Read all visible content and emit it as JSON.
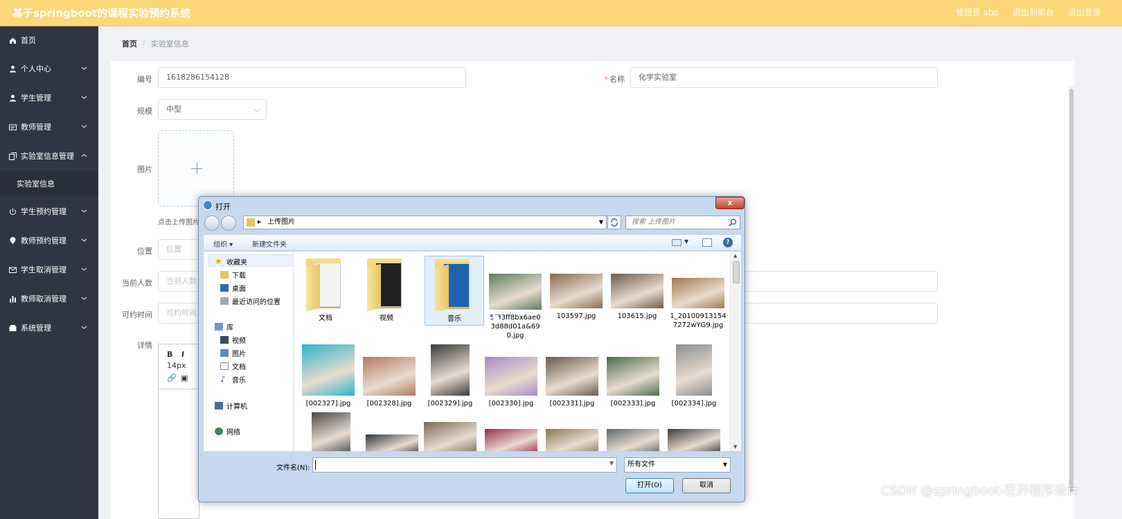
{
  "header": {
    "app_title": "基于springboot的课程实验预约系统",
    "user_label": "管理员 abo",
    "front_link": "退出到前台",
    "logout_link": "退出登录"
  },
  "sidebar": {
    "items": [
      {
        "label": "首页",
        "icon": "home-icon"
      },
      {
        "label": "个人中心",
        "icon": "user-icon"
      },
      {
        "label": "学生管理",
        "icon": "user-icon"
      },
      {
        "label": "教师管理",
        "icon": "id-card-icon"
      },
      {
        "label": "实验室信息管理",
        "icon": "copy-icon"
      },
      {
        "label": "学生预约管理",
        "icon": "power-icon"
      },
      {
        "label": "教师预约管理",
        "icon": "location-icon"
      },
      {
        "label": "学生取消管理",
        "icon": "mail-icon"
      },
      {
        "label": "教师取消管理",
        "icon": "bar-chart-icon"
      },
      {
        "label": "系统管理",
        "icon": "folder-icon"
      }
    ],
    "sub_item": "实验室信息"
  },
  "breadcrumb": {
    "home": "首页",
    "separator": "/",
    "current": "实验室信息"
  },
  "form": {
    "number_label": "编号",
    "number_value": "1618286154128",
    "name_label": "名称",
    "name_value": "化学实验室",
    "scale_label": "规模",
    "scale_value": "中型",
    "image_label": "图片",
    "upload_tip": "点击上传图片",
    "location_label": "位置",
    "location_placeholder": "位置",
    "count_label": "当前人数",
    "count_placeholder": "当前人数",
    "time_label": "可约时间",
    "time_placeholder": "可约时间",
    "detail_label": "详情",
    "editor_font_size": "14px"
  },
  "dialog": {
    "title": "打开",
    "close": "x",
    "path": "上传图片",
    "search_placeholder": "搜索 上传图片",
    "organize": "组织",
    "new_folder": "新建文件夹",
    "nav": {
      "favorites": "收藏夹",
      "downloads": "下载",
      "desktop": "桌面",
      "recent": "最近访问的位置",
      "libraries": "库",
      "videos": "视频",
      "pictures": "图片",
      "documents": "文档",
      "music": "音乐",
      "computer": "计算机",
      "network": "网络"
    },
    "files": [
      {
        "name": "文档",
        "kind": "folder"
      },
      {
        "name": "视频",
        "kind": "folder"
      },
      {
        "name": "音乐",
        "kind": "folder"
      },
      {
        "name": "5f33ff8bx6ae03d88d01a&690.jpg",
        "kind": "image",
        "color": "#5b7d5a"
      },
      {
        "name": "103597.jpg",
        "kind": "image",
        "color": "#8a6a4f"
      },
      {
        "name": "103615.jpg",
        "kind": "image",
        "color": "#6e5a4a"
      },
      {
        "name": "1_201009131547272wYG9.jpg",
        "kind": "image",
        "color": "#a0784a"
      },
      {
        "name": "[002327].jpg",
        "kind": "image",
        "color": "#2bb4c8"
      },
      {
        "name": "[002328].jpg",
        "kind": "image",
        "color": "#b07a60"
      },
      {
        "name": "[002329].jpg",
        "kind": "image",
        "color": "#3a3a3a"
      },
      {
        "name": "[002330].jpg",
        "kind": "image",
        "color": "#a68bc6"
      },
      {
        "name": "[002331].jpg",
        "kind": "image",
        "color": "#6b5a4e"
      },
      {
        "name": "[002333].jpg",
        "kind": "image",
        "color": "#4a6b4a"
      },
      {
        "name": "[002334].jpg",
        "kind": "image",
        "color": "#8a8e94"
      },
      {
        "name": "",
        "kind": "image",
        "color": "#4a4a4a"
      },
      {
        "name": "",
        "kind": "image",
        "color": "#2a3440"
      },
      {
        "name": "",
        "kind": "image",
        "color": "#7a6a58"
      },
      {
        "name": "",
        "kind": "image",
        "color": "#9a2a4a"
      },
      {
        "name": "",
        "kind": "image",
        "color": "#8a7a58"
      },
      {
        "name": "",
        "kind": "image",
        "color": "#5a6a6a"
      },
      {
        "name": "",
        "kind": "image",
        "color": "#3a3a3a"
      }
    ],
    "filename_label": "文件名(N):",
    "filename_value": "",
    "filetype": "所有文件",
    "open_button": "打开(O)",
    "cancel_button": "取消"
  },
  "watermark": "CSDN @springboot-花开程序设计",
  "colors": {
    "header": "#fcd777",
    "sidebar": "#2f3545"
  }
}
